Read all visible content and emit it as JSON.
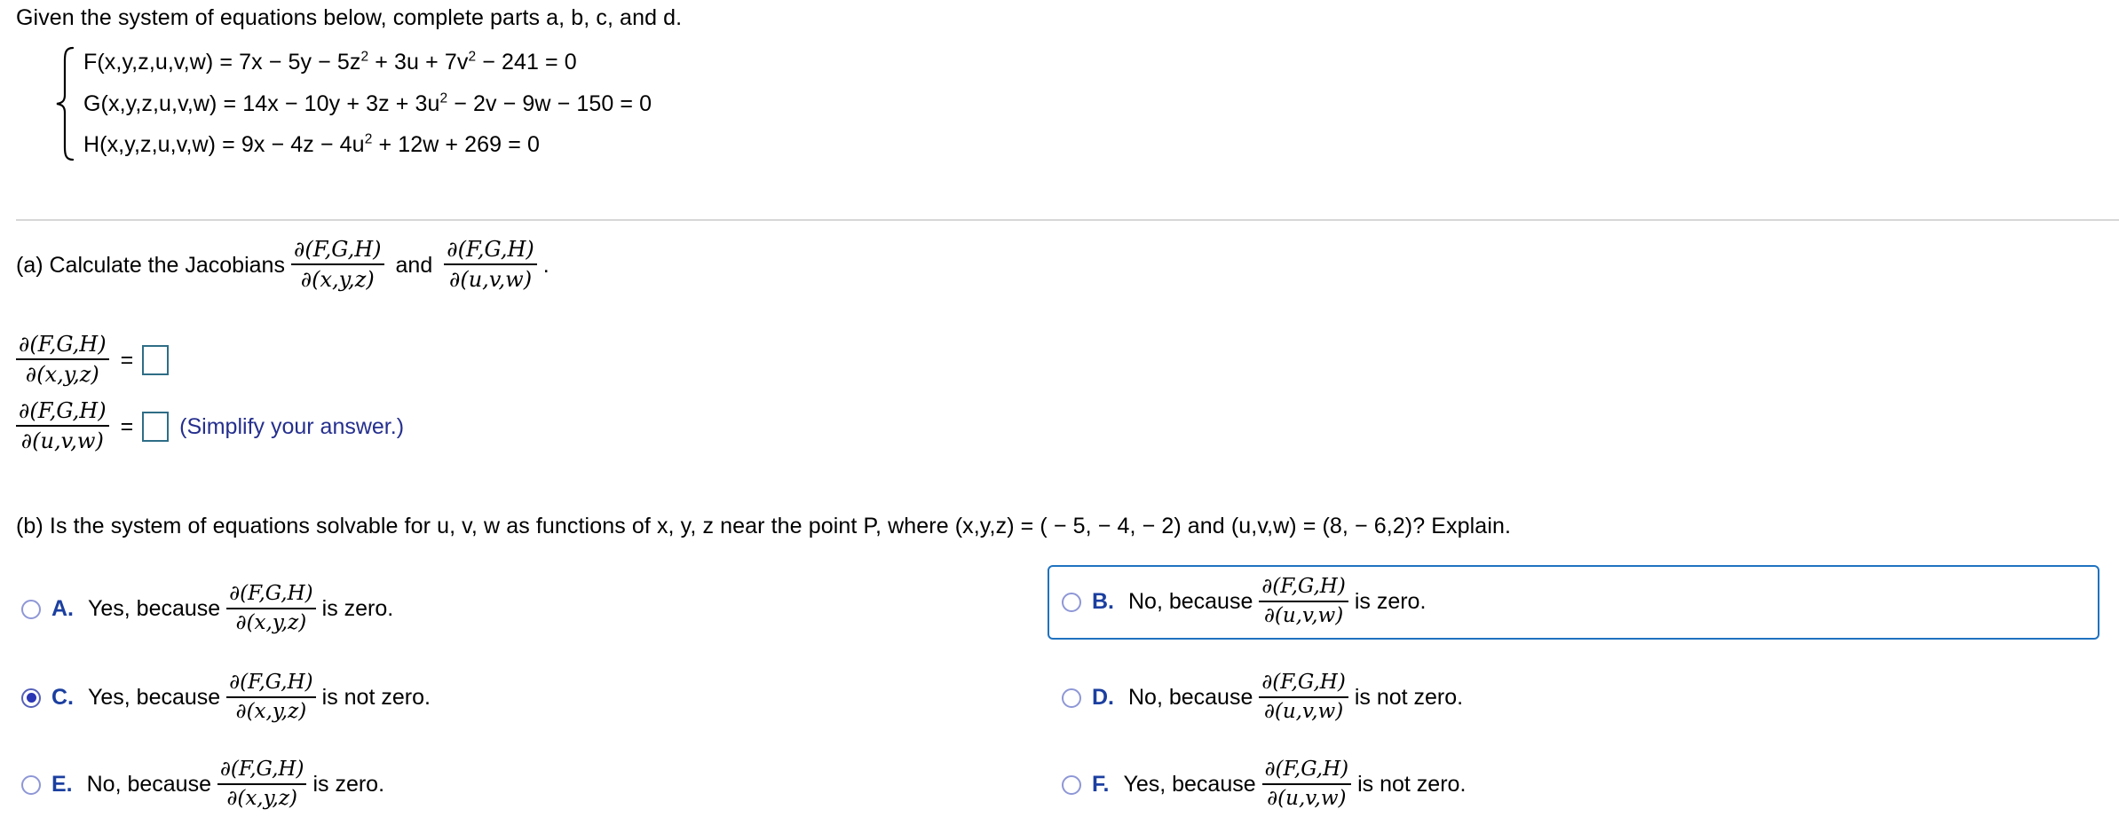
{
  "prompt": {
    "intro": "Given the system of equations below, complete parts a, b, c, and d."
  },
  "system": {
    "equations": [
      {
        "id": "F",
        "lhs": "F(x,y,z,u,v,w)",
        "parts": [
          {
            "t": "= 7x − 5y − 5z"
          },
          {
            "sup": "2"
          },
          {
            "t": " + 3u + 7v"
          },
          {
            "sup": "2"
          },
          {
            "t": " − 241 = 0"
          }
        ],
        "plain": "F(x,y,z,u,v,w) = 7x − 5y − 5z2 + 3u + 7v2 − 241 = 0"
      },
      {
        "id": "G",
        "lhs": "G(x,y,z,u,v,w)",
        "parts": [
          {
            "t": "= 14x − 10y + 3z + 3u"
          },
          {
            "sup": "2"
          },
          {
            "t": " − 2v − 9w − 150 = 0"
          }
        ],
        "plain": "G(x,y,z,u,v,w) = 14x − 10y + 3z + 3u2 − 2v − 9w − 150 = 0"
      },
      {
        "id": "H",
        "lhs": "H(x,y,z,u,v,w)",
        "parts": [
          {
            "t": "= 9x − 4z − 4u"
          },
          {
            "sup": "2"
          },
          {
            "t": " + 12w + 269 = 0"
          }
        ],
        "plain": "H(x,y,z,u,v,w) = 9x − 4z − 4u2 + 12w + 269 = 0"
      }
    ]
  },
  "jacobian": {
    "numerator": "∂(F,G,H)",
    "denominator_xyz": "∂(x,y,z)",
    "denominator_uvw": "∂(u,v,w)"
  },
  "part_a": {
    "label_before": "(a) Calculate the Jacobians",
    "conjunction": "and",
    "label_after": ".",
    "answer1": {
      "equals": "=",
      "value": "",
      "placeholder": ""
    },
    "answer2": {
      "equals": "=",
      "value": "",
      "placeholder": "",
      "hint": "(Simplify your answer.)"
    }
  },
  "part_b": {
    "question": "(b) Is the system of equations solvable for u, v, w as functions of x, y, z near the point P, where (x,y,z) = ( − 5, − 4, − 2) and (u,v,w) = (8, − 6,2)? Explain.",
    "point_xyz": "( − 5, − 4, − 2)",
    "point_uvw": "(8, − 6,2)",
    "choices": [
      {
        "letter": "A.",
        "prefix": "Yes, because",
        "denominator": "∂(x,y,z)",
        "suffix": "is zero.",
        "selected": false,
        "focused": false
      },
      {
        "letter": "B.",
        "prefix": "No, because",
        "denominator": "∂(u,v,w)",
        "suffix": "is zero.",
        "selected": false,
        "focused": true
      },
      {
        "letter": "C.",
        "prefix": "Yes, because",
        "denominator": "∂(x,y,z)",
        "suffix": "is not zero.",
        "selected": true,
        "focused": false
      },
      {
        "letter": "D.",
        "prefix": "No, because",
        "denominator": "∂(u,v,w)",
        "suffix": "is not zero.",
        "selected": false,
        "focused": false
      },
      {
        "letter": "E.",
        "prefix": "No, because",
        "denominator": "∂(x,y,z)",
        "suffix": "is zero.",
        "selected": false,
        "focused": false
      },
      {
        "letter": "F.",
        "prefix": "Yes, because",
        "denominator": "∂(u,v,w)",
        "suffix": "is not zero.",
        "selected": false,
        "focused": false
      }
    ]
  },
  "colors": {
    "input_border": "#2e6d86",
    "hint_text": "#252f8e",
    "choice_letter": "#1b3fa0",
    "radio_ring": "#8e97d6",
    "radio_fill": "#2b36b5",
    "focus_border": "#1f72c0",
    "divider": "#d7d7d7"
  }
}
